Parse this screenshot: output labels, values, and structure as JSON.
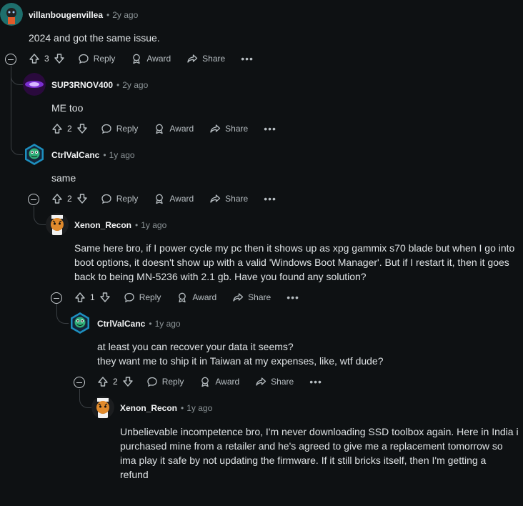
{
  "comments": [
    {
      "author": "villanbougenvillea",
      "time": "2y ago",
      "body": [
        "2024 and got the same issue."
      ],
      "votes": "3",
      "avatar_colors": [
        "#1e6f6d",
        "#e15b2a"
      ]
    },
    {
      "author": "SUP3RNOV400",
      "time": "2y ago",
      "body": [
        "ME too"
      ],
      "votes": "2",
      "avatar_colors": [
        "#2a0a3d",
        "#7a2ed1"
      ]
    },
    {
      "author": "CtrlValCanc",
      "time": "1y ago",
      "body": [
        "same"
      ],
      "votes": "2",
      "avatar_colors": [
        "#1d8fbf",
        "#2fae79"
      ]
    },
    {
      "author": "Xenon_Recon",
      "time": "1y ago",
      "body": [
        "Same here bro, if I power cycle my pc then it shows up as xpg gammix s70 blade but when I go into",
        "boot options, it doesn't show up with a valid 'Windows Boot Manager'. But if I restart it, then it goes",
        "back to being MN-5236 with 2.1 gb. Have you found any solution?"
      ],
      "votes": "1",
      "avatar_colors": [
        "#f2f2f2",
        "#e08a2c"
      ]
    },
    {
      "author": "CtrlValCanc",
      "time": "1y ago",
      "body": [
        "at least you can recover your data it seems?",
        "they want me to ship it in Taiwan at my expenses, like, wtf dude?"
      ],
      "votes": "2",
      "avatar_colors": [
        "#1d8fbf",
        "#2fae79"
      ]
    },
    {
      "author": "Xenon_Recon",
      "time": "1y ago",
      "body": [
        "Unbelievable incompetence bro, I'm never downloading SSD toolbox again. Here in India i",
        "purchased mine from a retailer and he's agreed to give me a replacement tomorrow so",
        "ima play it safe by not updating the firmware. If it still bricks itself, then I'm getting a",
        "refund"
      ],
      "avatar_colors": [
        "#f2f2f2",
        "#e08a2c"
      ]
    }
  ],
  "actions": {
    "reply": "Reply",
    "award": "Award",
    "share": "Share",
    "more": "•••"
  },
  "dot_separator": "•"
}
